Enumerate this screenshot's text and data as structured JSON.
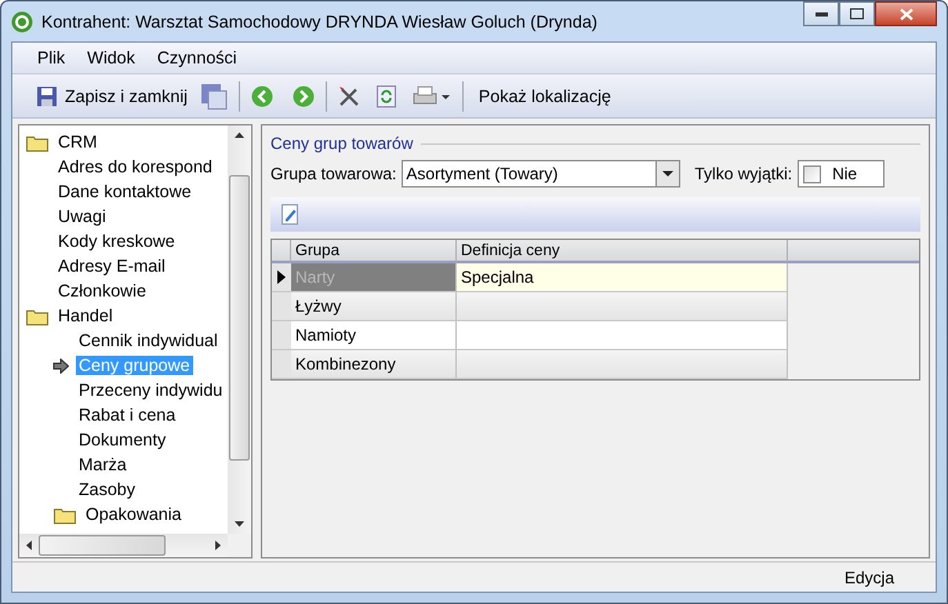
{
  "window": {
    "title": "Kontrahent: Warsztat Samochodowy DRYNDA Wiesław Goluch (Drynda)"
  },
  "menu": [
    "Plik",
    "Widok",
    "Czynności"
  ],
  "toolbar": {
    "save_close": "Zapisz i zamknij",
    "show_location": "Pokaż lokalizację"
  },
  "tree": [
    {
      "label": "CRM",
      "kind": "folder",
      "selected": false,
      "children": [
        {
          "label": "Adres do korespond",
          "kind": "leaf",
          "selected": false
        },
        {
          "label": "Dane kontaktowe",
          "kind": "leaf",
          "selected": false
        },
        {
          "label": "Uwagi",
          "kind": "leaf",
          "selected": false
        },
        {
          "label": "Kody kreskowe",
          "kind": "leaf",
          "selected": false
        },
        {
          "label": "Adresy E-mail",
          "kind": "leaf",
          "selected": false
        },
        {
          "label": "Członkowie",
          "kind": "leaf",
          "selected": false
        }
      ]
    },
    {
      "label": "Handel",
      "kind": "folder",
      "selected": false,
      "children": [
        {
          "label": "Cennik indywidual",
          "kind": "leaf",
          "selected": false
        },
        {
          "label": "Ceny grupowe",
          "kind": "leaf",
          "selected": true
        },
        {
          "label": "Przeceny indywidu",
          "kind": "leaf",
          "selected": false
        },
        {
          "label": "Rabat i cena",
          "kind": "leaf",
          "selected": false
        },
        {
          "label": "Dokumenty",
          "kind": "leaf",
          "selected": false
        },
        {
          "label": "Marża",
          "kind": "leaf",
          "selected": false
        },
        {
          "label": "Zasoby",
          "kind": "leaf",
          "selected": false
        },
        {
          "label": "Opakowania",
          "kind": "folder",
          "selected": false
        }
      ]
    }
  ],
  "panel": {
    "title": "Ceny grup towarów",
    "group_label": "Grupa towarowa:",
    "group_value": "Asortyment (Towary)",
    "exceptions_label": "Tylko wyjątki:",
    "exceptions_checked": false,
    "exceptions_value": "Nie"
  },
  "table": {
    "columns": [
      "Grupa",
      "Definicja ceny"
    ],
    "rows": [
      {
        "group": "Narty",
        "definition": "Specjalna",
        "selected": true
      },
      {
        "group": "Łyżwy",
        "selected": false
      },
      {
        "group": "Namioty",
        "selected": false
      },
      {
        "group": "Kombinezony",
        "selected": false
      }
    ]
  },
  "status_bar": "Edycja"
}
